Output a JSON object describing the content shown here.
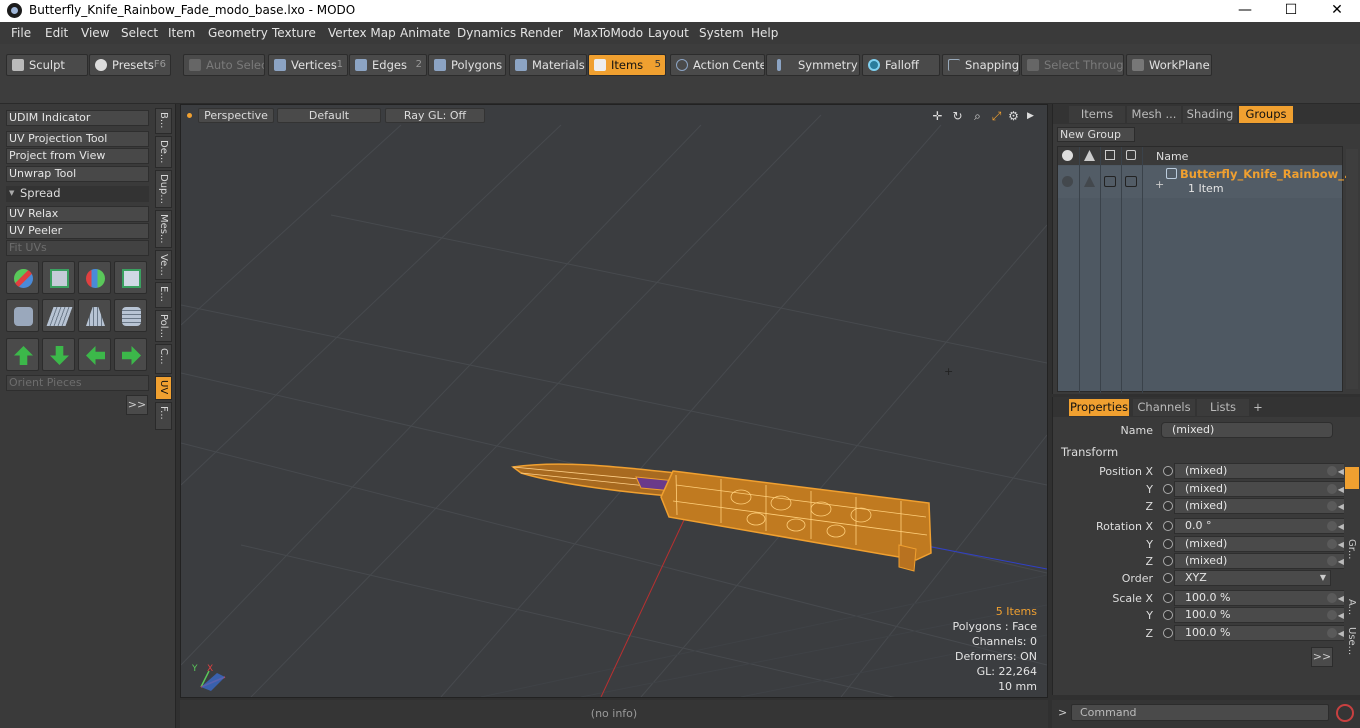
{
  "window": {
    "title": "Butterfly_Knife_Rainbow_Fade_modo_base.lxo - MODO",
    "minimize": "—",
    "maximize": "☐",
    "close": "✕"
  },
  "menu": [
    "File",
    "Edit",
    "View",
    "Select",
    "Item",
    "Geometry",
    "Texture",
    "Vertex Map",
    "Animate",
    "Dynamics",
    "Render",
    "MaxToModo",
    "Layout",
    "System",
    "Help"
  ],
  "toolbar": {
    "sculpt": "Sculpt",
    "presets": "Presets",
    "presets_key": "F6",
    "auto_select": "Auto Select",
    "vertices": "Vertices",
    "vertices_num": "1",
    "edges": "Edges",
    "edges_num": "2",
    "polygons": "Polygons",
    "materials": "Materials",
    "items": "Items",
    "items_num": "5",
    "action_center": "Action Center",
    "symmetry": "Symmetry",
    "falloff": "Falloff",
    "snapping": "Snapping",
    "select_through": "Select Through",
    "workplane": "WorkPlane"
  },
  "left": {
    "udim": "UDIM Indicator",
    "uv_projection": "UV Projection Tool",
    "project_view": "Project from View",
    "unwrap": "Unwrap Tool",
    "spread": "Spread",
    "uv_relax": "UV Relax",
    "uv_peeler": "UV Peeler",
    "fit_uvs": "Fit UVs",
    "orient_pieces": "Orient Pieces",
    "more": ">>",
    "vtabs": [
      "B...",
      "De...",
      "Dup...",
      "Mes...",
      "Ve...",
      "E...",
      "Pol...",
      "C...",
      "UV",
      "F..."
    ]
  },
  "viewport": {
    "perspective": "Perspective",
    "default": "Default",
    "raygl": "Ray GL: Off",
    "info_items": "5 Items",
    "info_polygons": "Polygons : Face",
    "info_channels": "Channels: 0",
    "info_deformers": "Deformers: ON",
    "info_gl": "GL: 22,264",
    "info_size": "10 mm",
    "axis_y": "Y",
    "axis_x": "X",
    "tool_move": "✛",
    "tool_rotate": "↻",
    "tool_zoom": "⌕",
    "tool_fit": "⤢",
    "tool_gear": "⚙",
    "tool_play": "▶"
  },
  "groups_panel": {
    "tabs": [
      "Items",
      "Mesh ...",
      "Shading",
      "Groups"
    ],
    "new_group": "New Group",
    "col_name": "Name",
    "group_name": "Butterfly_Knife_Rainbow_...",
    "group_count": "1 Item",
    "expand": "+"
  },
  "properties_panel": {
    "tabs": [
      "Properties",
      "Channels",
      "Lists"
    ],
    "add_tab": "+",
    "name_label": "Name",
    "name_value": "(mixed)",
    "transform": "Transform",
    "position_x_label": "Position X",
    "position_x": "(mixed)",
    "position_y_label": "Y",
    "position_y": "(mixed)",
    "position_z_label": "Z",
    "position_z": "(mixed)",
    "rotation_x_label": "Rotation X",
    "rotation_x": "0.0 °",
    "rotation_y_label": "Y",
    "rotation_y": "(mixed)",
    "rotation_z_label": "Z",
    "rotation_z": "(mixed)",
    "order_label": "Order",
    "order_value": "XYZ",
    "scale_x_label": "Scale X",
    "scale_x": "100.0 %",
    "scale_y_label": "Y",
    "scale_y": "100.0 %",
    "scale_z_label": "Z",
    "scale_z": "100.0 %",
    "more": ">>",
    "side_tabs": [
      "Gr...",
      "A...",
      "Use..."
    ]
  },
  "status": {
    "info": "(no info)",
    "cmd_prompt": ">",
    "command_placeholder": "Command"
  },
  "colors": {
    "accent": "#f0a030",
    "wire": "#f0a030",
    "viewport_bg": "#3b3d40"
  }
}
